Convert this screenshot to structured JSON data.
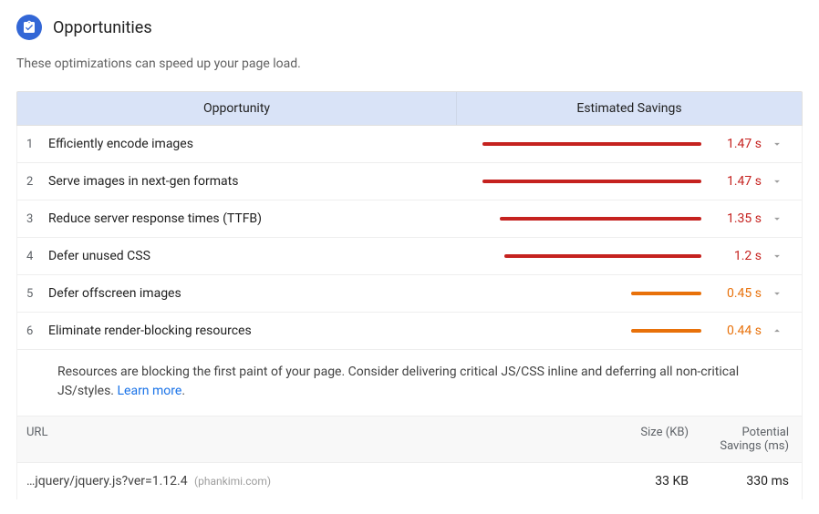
{
  "header": {
    "title": "Opportunities",
    "subtitle": "These optimizations can speed up your page load."
  },
  "columns": {
    "opportunity": "Opportunity",
    "savings": "Estimated Savings"
  },
  "rows": [
    {
      "idx": "1",
      "label": "Efficiently encode images",
      "savings": "1.47 s",
      "color": "red",
      "barPct": 100,
      "expanded": false
    },
    {
      "idx": "2",
      "label": "Serve images in next-gen formats",
      "savings": "1.47 s",
      "color": "red",
      "barPct": 100,
      "expanded": false
    },
    {
      "idx": "3",
      "label": "Reduce server response times (TTFB)",
      "savings": "1.35 s",
      "color": "red",
      "barPct": 92,
      "expanded": false
    },
    {
      "idx": "4",
      "label": "Defer unused CSS",
      "savings": "1.2 s",
      "color": "red",
      "barPct": 90,
      "expanded": false
    },
    {
      "idx": "5",
      "label": "Defer offscreen images",
      "savings": "0.45 s",
      "color": "orange",
      "barPct": 32,
      "expanded": false
    },
    {
      "idx": "6",
      "label": "Eliminate render-blocking resources",
      "savings": "0.44 s",
      "color": "orange",
      "barPct": 32,
      "expanded": true
    }
  ],
  "expanded": {
    "description": "Resources are blocking the first paint of your page. Consider delivering critical JS/CSS inline and deferring all non-critical JS/styles.",
    "learnMore": "Learn more",
    "subtable": {
      "headers": {
        "url": "URL",
        "size": "Size (KB)",
        "savings_l1": "Potential",
        "savings_l2": "Savings (ms)"
      },
      "rows": [
        {
          "url": "…jquery/jquery.js?ver=1.12.4",
          "domain": "(phankimi.com)",
          "size": "33 KB",
          "savings": "330 ms"
        }
      ]
    }
  }
}
